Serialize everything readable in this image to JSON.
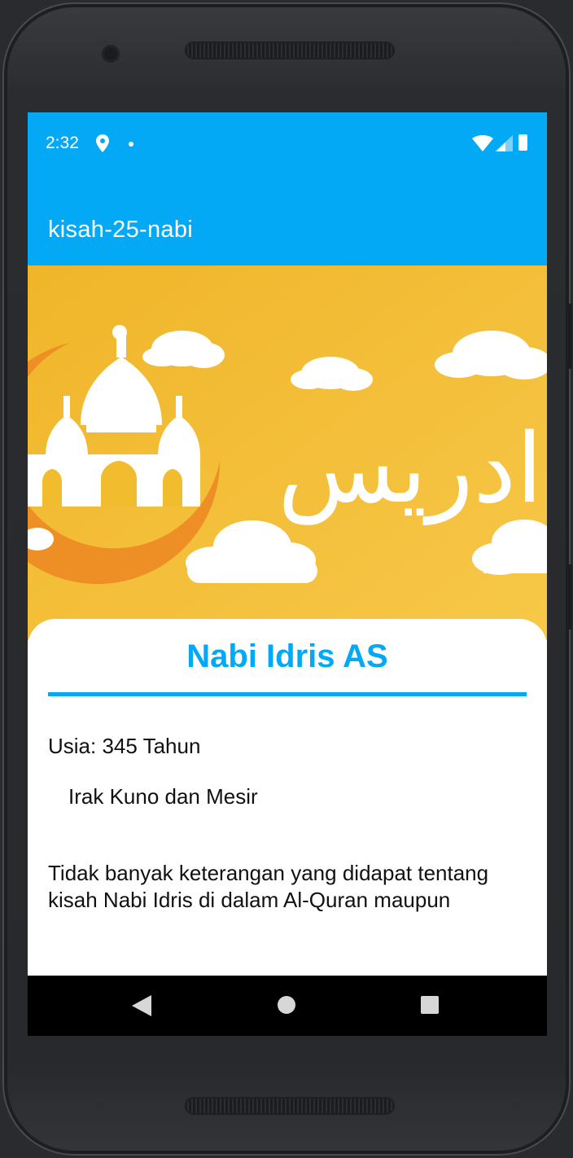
{
  "status_bar": {
    "time": "2:32",
    "icons": [
      "location-icon",
      "notification-dot-icon",
      "wifi-icon",
      "cell-signal-icon",
      "battery-icon"
    ]
  },
  "app_bar": {
    "title": "kisah-25-nabi"
  },
  "hero": {
    "description_icon": "mosque-crescent-clouds-illustration",
    "arabic_text": "ادريس"
  },
  "prophet": {
    "name": "Nabi Idris AS",
    "age": "Usia: 345 Tahun",
    "place": "Irak Kuno dan Mesir",
    "story": "Tidak banyak keterangan yang didapat tentang kisah Nabi Idris di dalam Al-Quran maupun"
  },
  "nav_bar": {
    "back_icon": "back-triangle-icon",
    "home_icon": "home-circle-icon",
    "recent_icon": "recent-apps-square-icon"
  },
  "colors": {
    "primary": "#03a9f4",
    "hero_bg": "#f2bc2f",
    "crescent": "#ee8f26",
    "nav_bg": "#000000"
  }
}
